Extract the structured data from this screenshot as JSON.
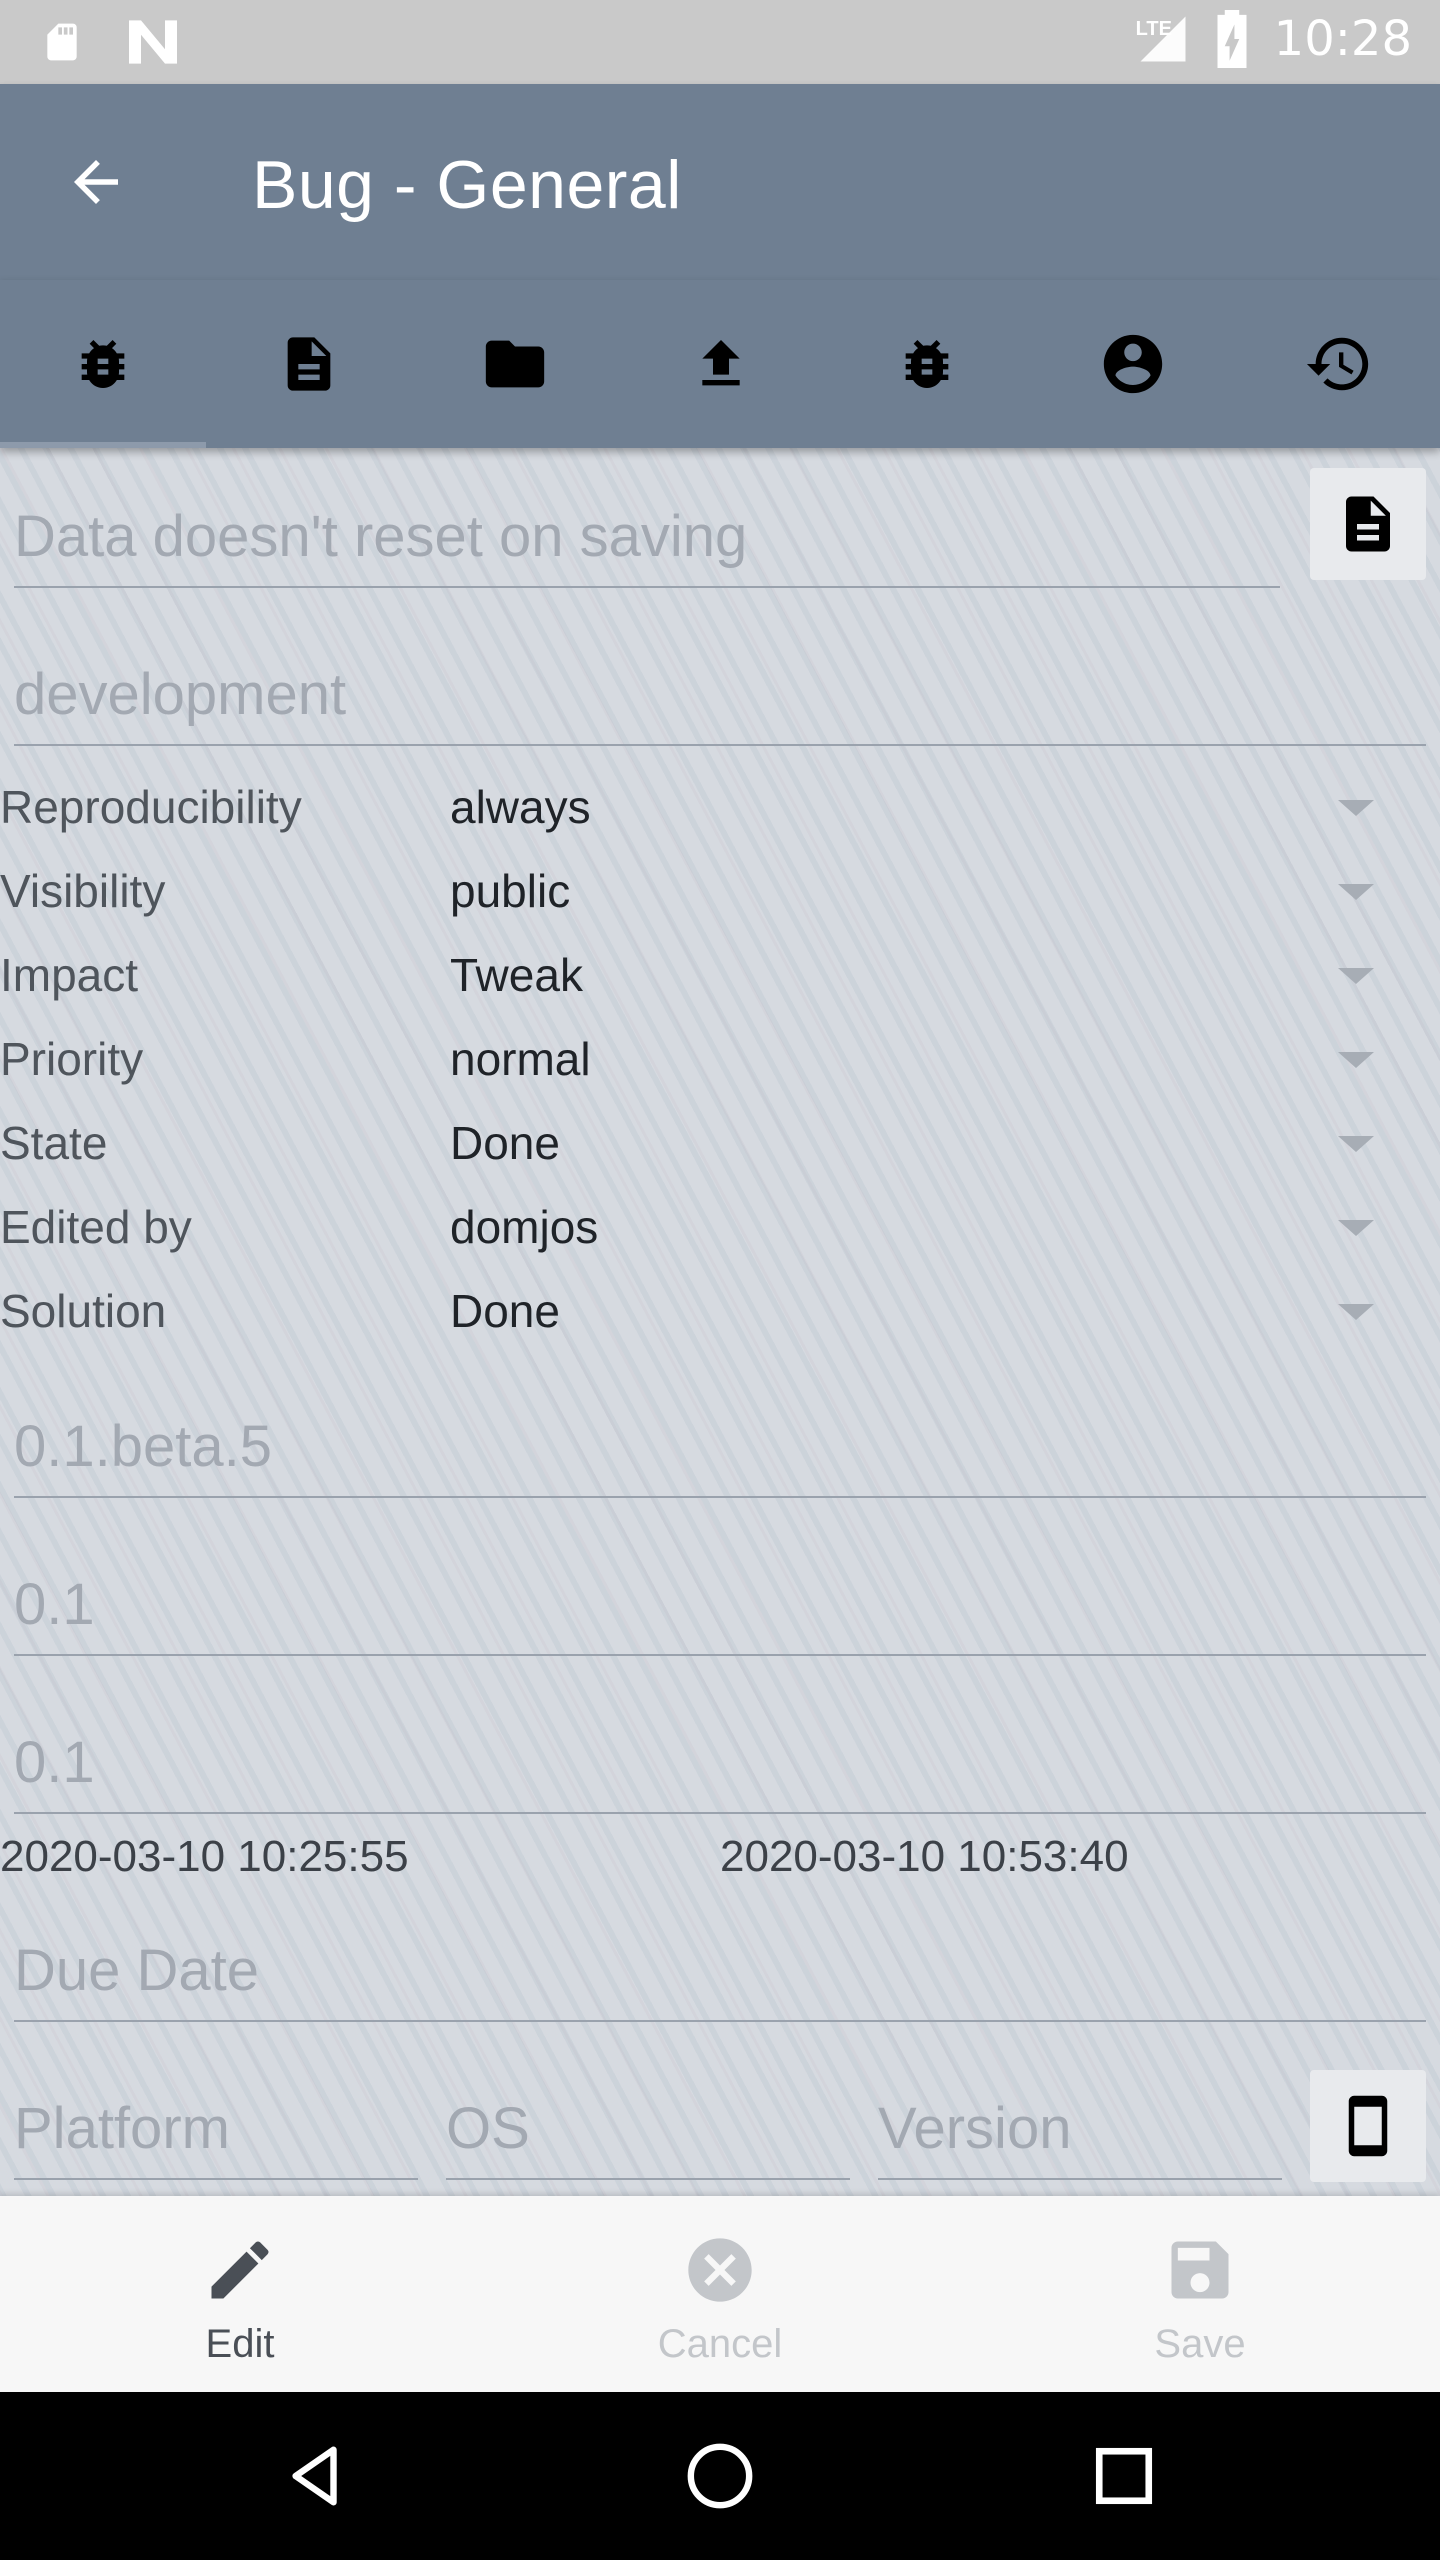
{
  "status_bar": {
    "time": "10:28",
    "network": "LTE",
    "icons": [
      "sd-card-icon",
      "notification-n-icon",
      "signal-icon",
      "battery-charging-icon"
    ]
  },
  "app_bar": {
    "title": "Bug - General",
    "back_icon": "arrow-back-icon"
  },
  "tabs": [
    {
      "icon": "bug-icon"
    },
    {
      "icon": "document-icon"
    },
    {
      "icon": "folder-icon"
    },
    {
      "icon": "upload-icon"
    },
    {
      "icon": "bug-icon"
    },
    {
      "icon": "account-circle-icon"
    },
    {
      "icon": "history-icon"
    }
  ],
  "form": {
    "summary_placeholder": "Data doesn't reset on saving",
    "category_placeholder": "development",
    "fields": [
      {
        "label": "Reproducibility",
        "value": "always"
      },
      {
        "label": "Visibility",
        "value": "public"
      },
      {
        "label": "Impact",
        "value": "Tweak"
      },
      {
        "label": "Priority",
        "value": "normal"
      },
      {
        "label": "State",
        "value": "Done"
      },
      {
        "label": "Edited by",
        "value": "domjos"
      },
      {
        "label": "Solution",
        "value": "Done"
      }
    ],
    "version_placeholder": "0.1.beta.5",
    "fixed_in_placeholder": "0.1",
    "target_placeholder": "0.1",
    "created": "2020-03-10 10:25:55",
    "updated": "2020-03-10 10:53:40",
    "due_date_placeholder": "Due Date",
    "platform_placeholder": "Platform",
    "os_placeholder": "OS",
    "os_version_placeholder": "Version"
  },
  "bottom_actions": {
    "edit_label": "Edit",
    "cancel_label": "Cancel",
    "save_label": "Save"
  },
  "colors": {
    "app_bar": "#6f7f92",
    "status_bar": "#c9c9c9",
    "bottom_bar": "#f7f7f7",
    "active_action": "#4a4f56",
    "disabled_action": "#c3c6ca"
  }
}
